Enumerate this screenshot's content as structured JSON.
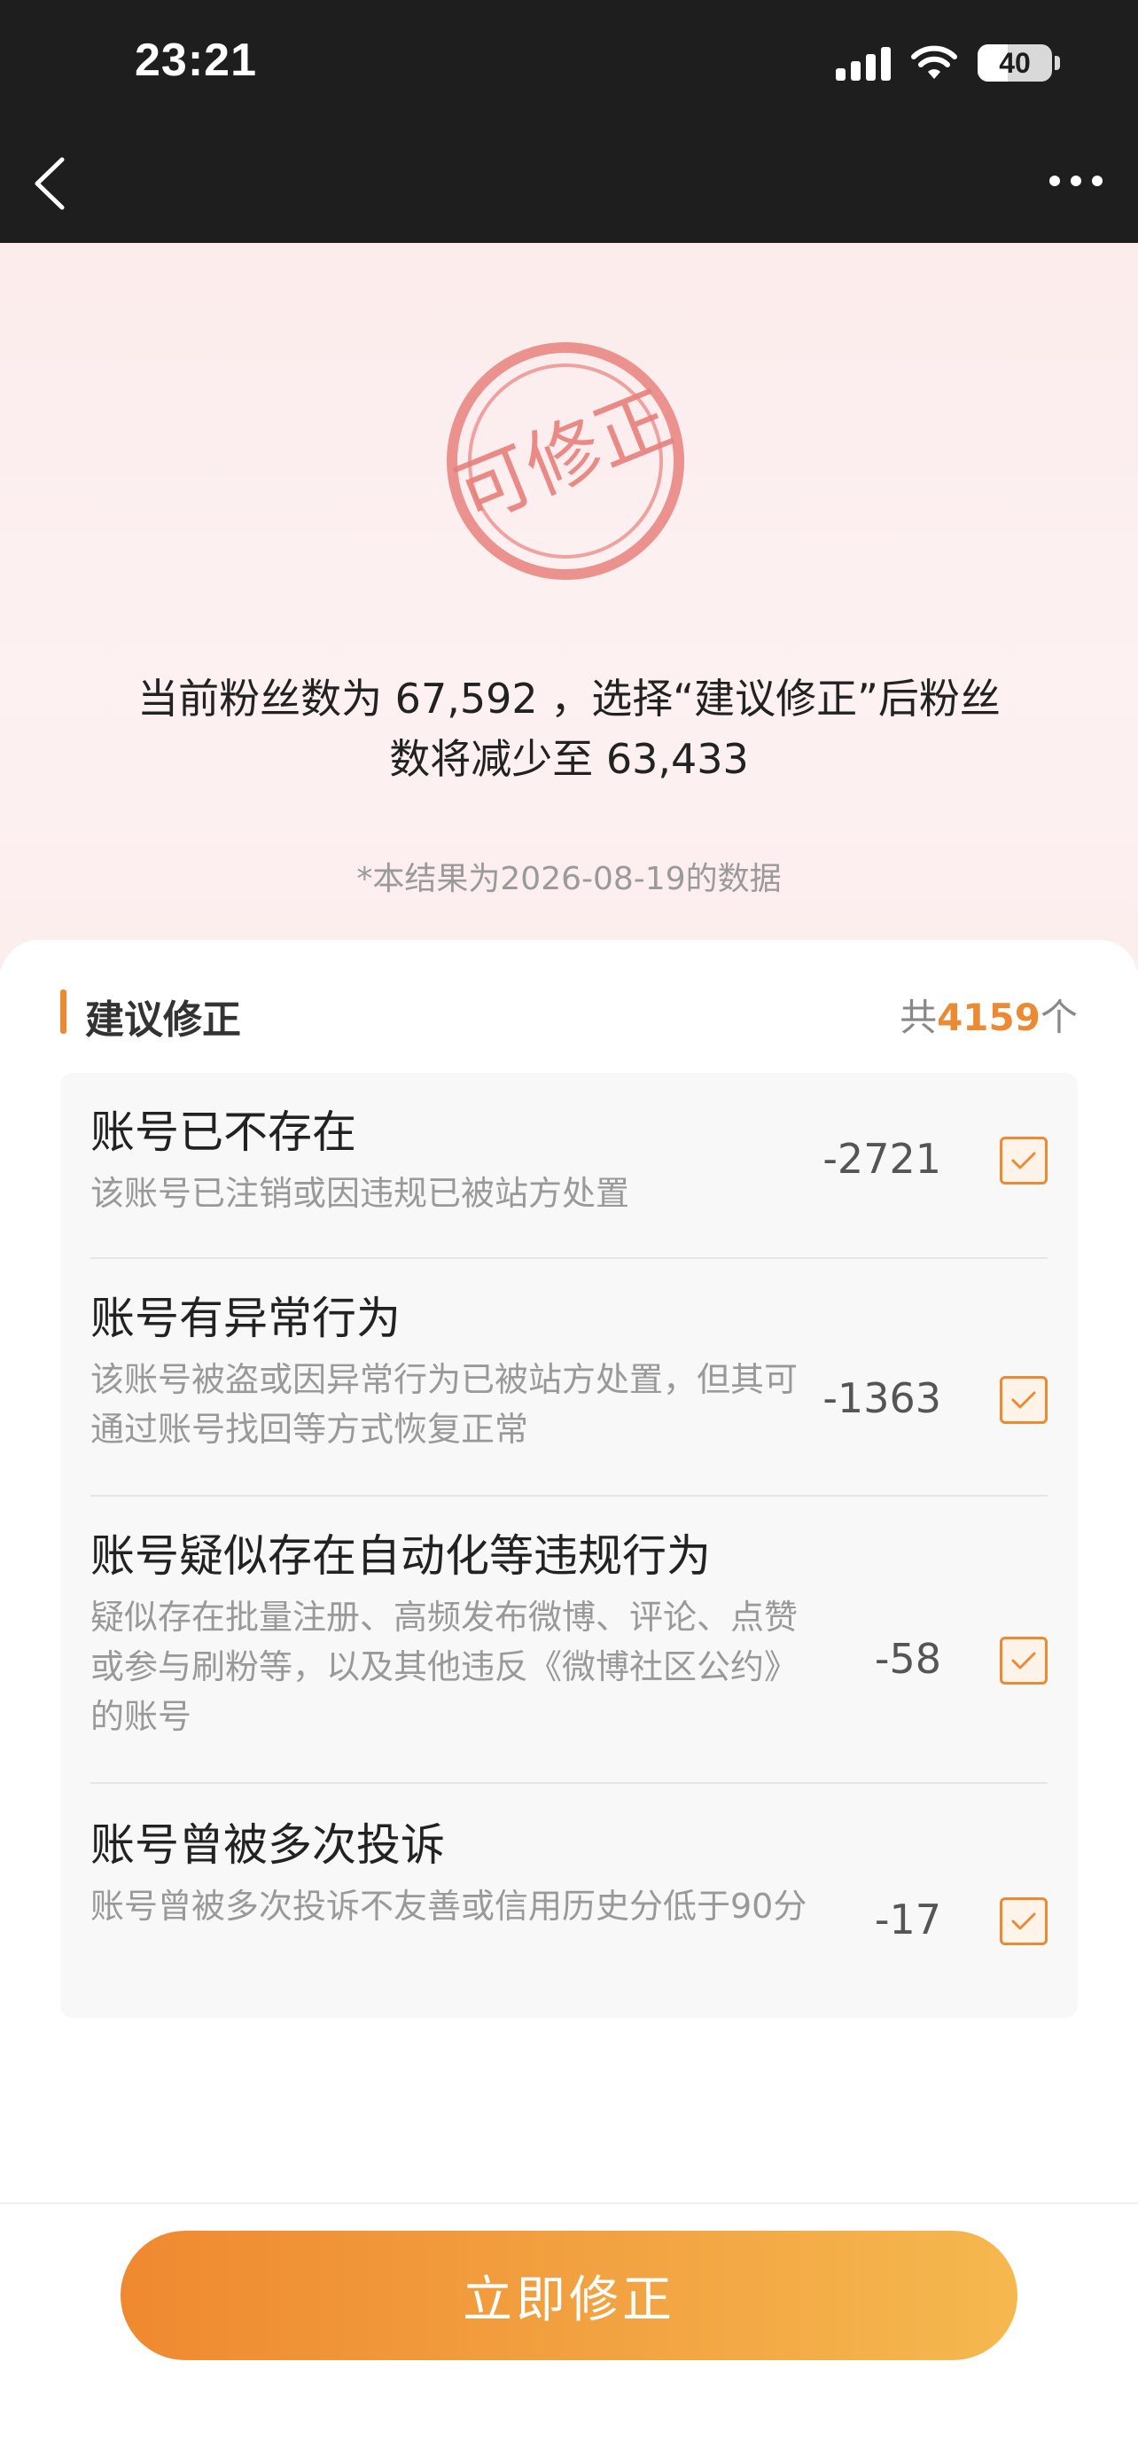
{
  "status_bar": {
    "time": "23:21",
    "battery": "40"
  },
  "nav": {
    "back_icon": "chevron-left-icon",
    "more_icon": "more-horizontal-icon"
  },
  "hero": {
    "stamp_text": "可修正",
    "summary_line1": "当前粉丝数为 67,592 ，选择“建议修正”后粉丝",
    "summary_line2": "数将减少至 63,433",
    "note": "*本结果为2026-08-19的数据"
  },
  "section": {
    "title": "建议修正",
    "count_prefix": "共",
    "count": "4159",
    "count_suffix": "个"
  },
  "items": [
    {
      "title": "账号已不存在",
      "desc": "该账号已注销或因违规已被站方处置",
      "value": "-2721",
      "checked": true
    },
    {
      "title": "账号有异常行为",
      "desc": "该账号被盗或因异常行为已被站方处置，但其可通过账号找回等方式恢复正常",
      "value": "-1363",
      "checked": true
    },
    {
      "title": "账号疑似存在自动化等违规行为",
      "desc": "疑似存在批量注册、高频发布微博、评论、点赞或参与刷粉等，以及其他违反《微博社区公约》的账号",
      "value": "-58",
      "checked": true
    },
    {
      "title": "账号曾被多次投诉",
      "desc": "账号曾被多次投诉不友善或信用历史分低于90分",
      "value": "-17",
      "checked": true
    }
  ],
  "cta": {
    "label": "立即修正"
  },
  "colors": {
    "accent": "#ec8a33",
    "stamp": "#e8807c",
    "cta_start": "#ef8930",
    "cta_end": "#f5b84f"
  }
}
